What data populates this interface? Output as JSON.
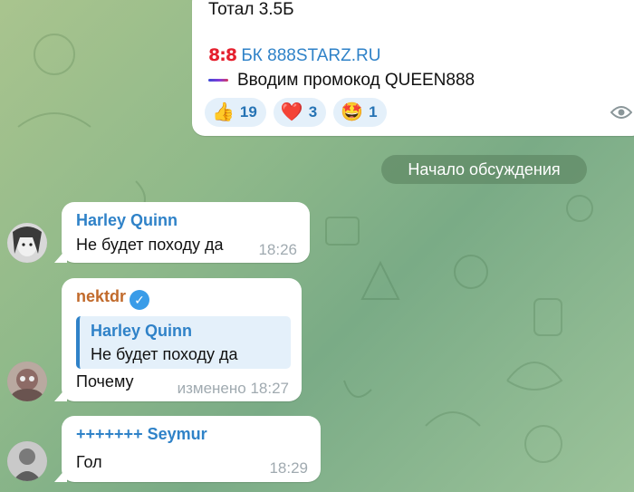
{
  "channel_post": {
    "line1": "Тотал 3.5Б",
    "line2_logo": "8:8",
    "line2_link": "БК 888STARZ.RU",
    "line3": "Вводим промокод QUEEN888",
    "reactions": [
      {
        "emoji": "👍",
        "count": "19"
      },
      {
        "emoji": "❤️",
        "count": "3"
      },
      {
        "emoji": "🤩",
        "count": "1"
      }
    ],
    "views_icon": "eye-icon"
  },
  "service_message": "Начало обсуждения",
  "messages": [
    {
      "sender": "Harley Quinn",
      "text": "Не будет походу да",
      "time": "18:26"
    },
    {
      "sender": "nektdr",
      "verified": true,
      "reply": {
        "sender": "Harley Quinn",
        "text": "Не будет походу да"
      },
      "text": "Почему",
      "time": "изменено 18:27"
    },
    {
      "sender": "+++++++ Seymur",
      "text": "Гол",
      "time": "18:29"
    }
  ],
  "colors": {
    "link": "#2f82c8",
    "sender_orange": "#c16a2b",
    "reaction_bg": "#e4f0fa"
  }
}
